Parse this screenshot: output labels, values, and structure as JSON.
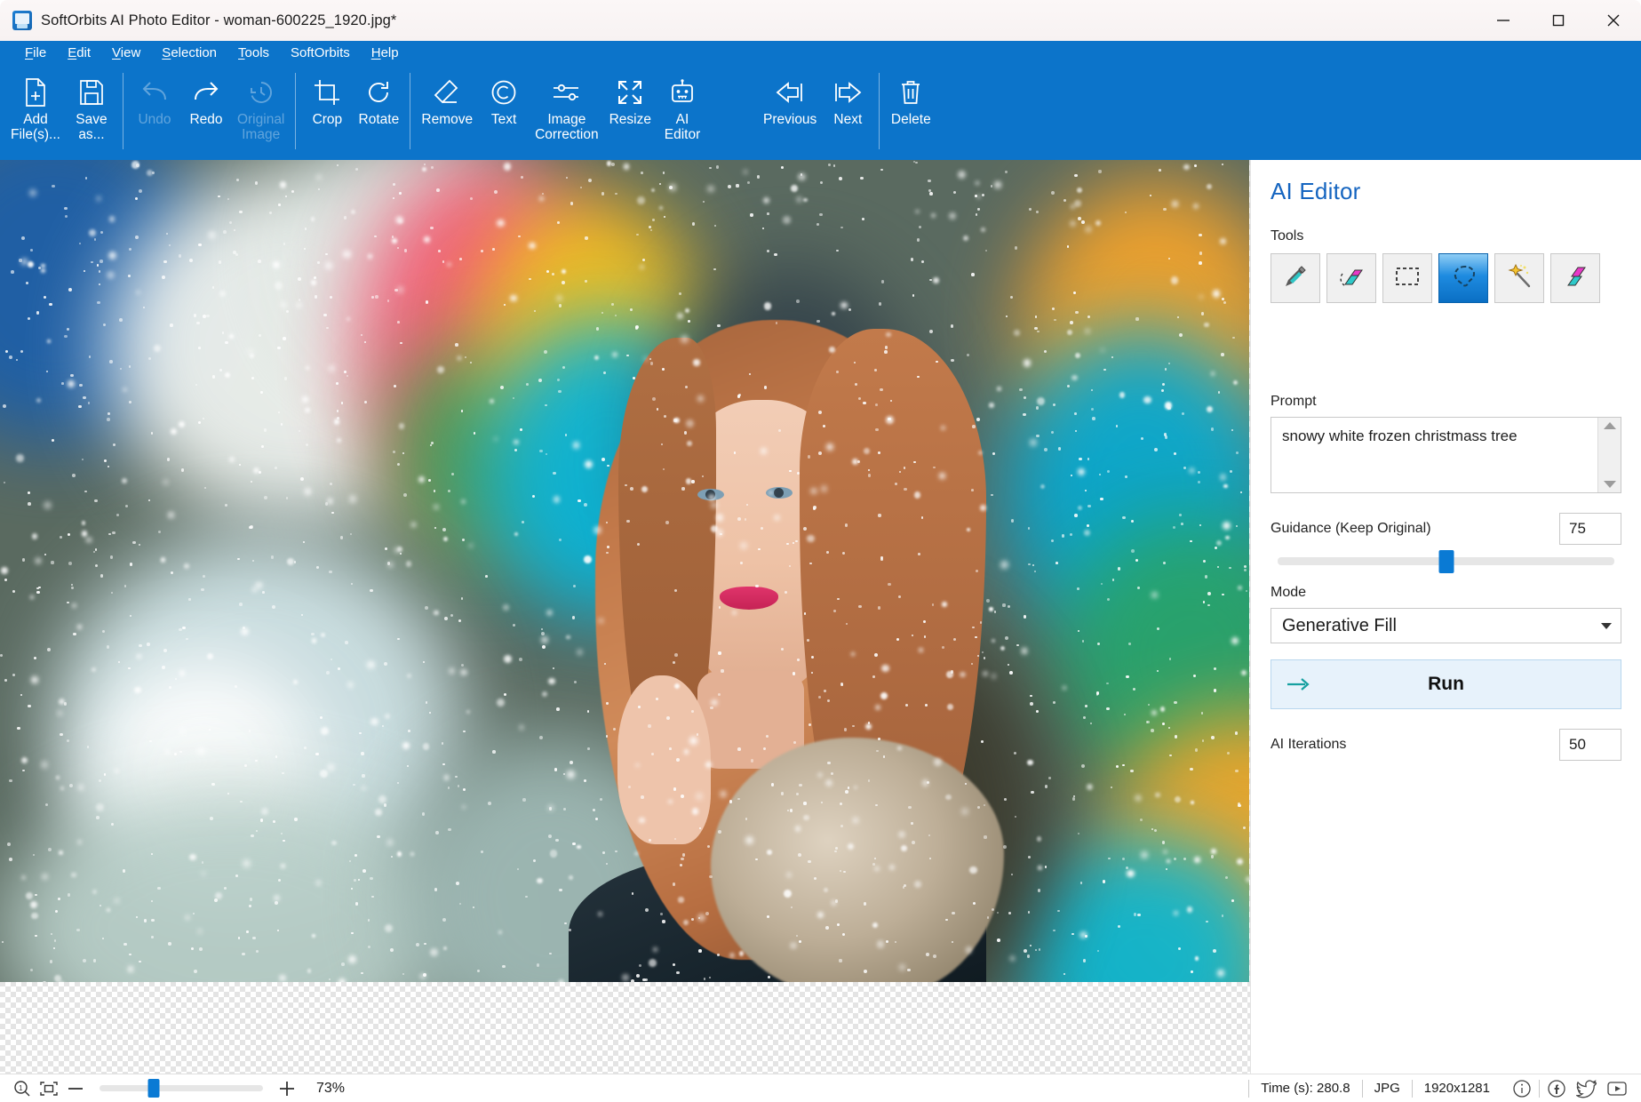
{
  "window": {
    "title": "SoftOrbits AI Photo Editor - woman-600225_1920.jpg*",
    "app_icon": "app-logo-icon",
    "minimize": "minimize-icon",
    "maximize": "maximize-icon",
    "close": "close-icon"
  },
  "menubar": {
    "items": [
      {
        "label": "File",
        "accel": "F"
      },
      {
        "label": "Edit",
        "accel": "E"
      },
      {
        "label": "View",
        "accel": "V"
      },
      {
        "label": "Selection",
        "accel": "S"
      },
      {
        "label": "Tools",
        "accel": "T"
      },
      {
        "label": "SoftOrbits",
        "accel": ""
      },
      {
        "label": "Help",
        "accel": "H"
      }
    ]
  },
  "toolbar": {
    "buttons": [
      {
        "id": "add-files",
        "label": "Add\nFile(s)...",
        "icon": "file-plus-icon",
        "enabled": true
      },
      {
        "id": "save-as",
        "label": "Save\nas...",
        "icon": "save-disk-icon",
        "enabled": true
      },
      {
        "id": "undo",
        "label": "Undo",
        "icon": "undo-arrow-icon",
        "enabled": false
      },
      {
        "id": "redo",
        "label": "Redo",
        "icon": "redo-arrow-icon",
        "enabled": true
      },
      {
        "id": "original-image",
        "label": "Original\nImage",
        "icon": "history-clock-icon",
        "enabled": false
      },
      {
        "id": "crop",
        "label": "Crop",
        "icon": "crop-icon",
        "enabled": true
      },
      {
        "id": "rotate",
        "label": "Rotate",
        "icon": "rotate-cw-icon",
        "enabled": true
      },
      {
        "id": "remove",
        "label": "Remove",
        "icon": "eraser-icon",
        "enabled": true
      },
      {
        "id": "text",
        "label": "Text",
        "icon": "copyright-icon",
        "enabled": true
      },
      {
        "id": "image-correction",
        "label": "Image\nCorrection",
        "icon": "sliders-icon",
        "enabled": true
      },
      {
        "id": "resize",
        "label": "Resize",
        "icon": "expand-arrows-icon",
        "enabled": true
      },
      {
        "id": "ai-editor",
        "label": "AI\nEditor",
        "icon": "robot-icon",
        "enabled": true
      },
      {
        "id": "previous",
        "label": "Previous",
        "icon": "arrow-left-icon",
        "enabled": true
      },
      {
        "id": "next",
        "label": "Next",
        "icon": "arrow-right-icon",
        "enabled": true
      },
      {
        "id": "delete",
        "label": "Delete",
        "icon": "trash-icon",
        "enabled": true
      }
    ]
  },
  "panel": {
    "title": "AI Editor",
    "tools_label": "Tools",
    "tools": [
      {
        "id": "brush",
        "icon": "marker-brush-icon",
        "active": false
      },
      {
        "id": "eraser",
        "icon": "color-eraser-icon",
        "active": false
      },
      {
        "id": "rect-select",
        "icon": "rectangle-select-icon",
        "active": false
      },
      {
        "id": "lasso",
        "icon": "lasso-select-icon",
        "active": true
      },
      {
        "id": "magic-wand",
        "icon": "magic-wand-icon",
        "active": false
      },
      {
        "id": "fill",
        "icon": "gradient-fill-icon",
        "active": false
      }
    ],
    "prompt_label": "Prompt",
    "prompt_value": "snowy white frozen christmass tree",
    "guidance_label": "Guidance (Keep Original)",
    "guidance_value": "75",
    "guidance_percent": 50,
    "mode_label": "Mode",
    "mode_value": "Generative Fill",
    "run_label": "Run",
    "run_icon": "arrow-right-run-icon",
    "iterations_label": "AI Iterations",
    "iterations_value": "50"
  },
  "statusbar": {
    "zoom_one_to_one_icon": "magnifier-one-icon",
    "fit_screen_icon": "fit-to-screen-icon",
    "zoom_out_icon": "minus-icon",
    "zoom_in_icon": "plus-icon",
    "zoom_percent": "73%",
    "zoom_slider_percent": 33,
    "time_label": "Time (s): 280.8",
    "format": "JPG",
    "dimensions": "1920x1281",
    "info_icon": "info-circle-icon",
    "facebook_icon": "facebook-icon",
    "twitter_icon": "twitter-bird-icon",
    "youtube_icon": "youtube-icon"
  },
  "colors": {
    "accent_blue": "#0c74ca",
    "panel_title_blue": "#1565c0",
    "slider_blue": "#0a7ad4",
    "run_bg": "#e7f2fb"
  }
}
